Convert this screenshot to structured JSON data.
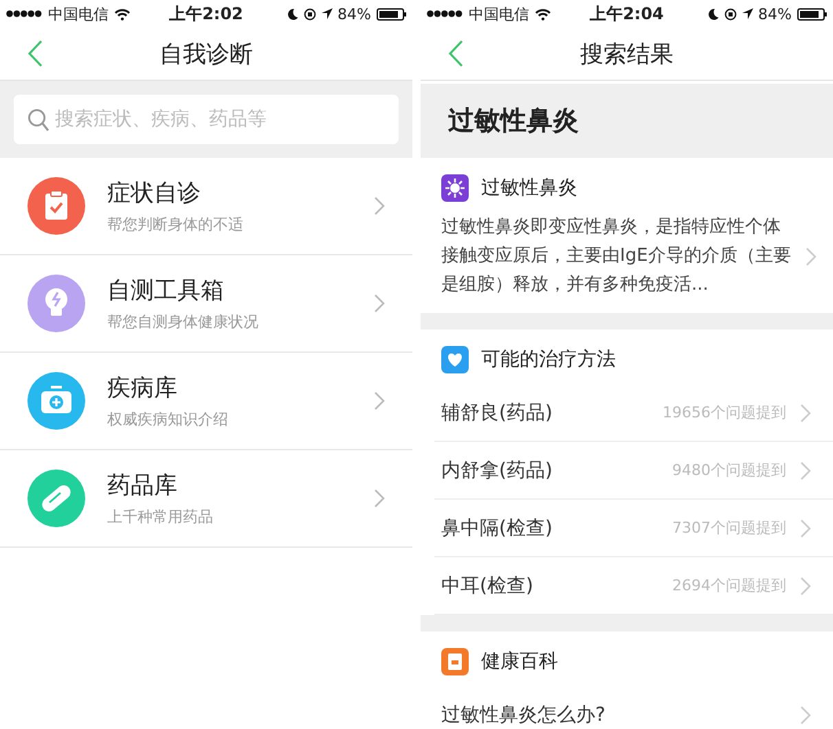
{
  "screens": [
    {
      "status_bar": {
        "carrier": "中国电信",
        "time": "上午2:02",
        "battery": "84%"
      },
      "nav": {
        "title": "自我诊断"
      },
      "search": {
        "placeholder": "搜索症状、疾病、药品等"
      },
      "menu": [
        {
          "kind": "clipboard",
          "color": "#f2624c",
          "title": "症状自诊",
          "subtitle": "帮您判断身体的不适"
        },
        {
          "kind": "bulb",
          "color": "#b9a4f2",
          "title": "自测工具箱",
          "subtitle": "帮您自测身体健康状况"
        },
        {
          "kind": "kit",
          "color": "#27b8ee",
          "title": "疾病库",
          "subtitle": "权威疾病知识介绍"
        },
        {
          "kind": "pill",
          "color": "#21d09a",
          "title": "药品库",
          "subtitle": "上千种常用药品"
        }
      ]
    },
    {
      "status_bar": {
        "carrier": "中国电信",
        "time": "上午2:04",
        "battery": "84%"
      },
      "nav": {
        "title": "搜索结果"
      },
      "query_heading": "过敏性鼻炎",
      "sections": [
        {
          "kind": "summary",
          "color": "#7b3fd6",
          "title": "过敏性鼻炎",
          "text": "过敏性鼻炎即变应性鼻炎，是指特应性个体接触变应原后，主要由IgE介导的介质（主要是组胺）释放，并有多种免疫活..."
        },
        {
          "kind": "list",
          "color": "#2a9ff0",
          "title": "可能的治疗方法",
          "rows": [
            {
              "label": "辅舒良(药品)",
              "count": "19656个问题提到"
            },
            {
              "label": "内舒拿(药品)",
              "count": "9480个问题提到"
            },
            {
              "label": "鼻中隔(检查)",
              "count": "7307个问题提到"
            },
            {
              "label": "中耳(检查)",
              "count": "2694个问题提到"
            }
          ]
        },
        {
          "kind": "list",
          "color": "#f27a2a",
          "title": "健康百科",
          "rows": [
            {
              "label": "过敏性鼻炎怎么办?"
            }
          ]
        }
      ]
    }
  ]
}
